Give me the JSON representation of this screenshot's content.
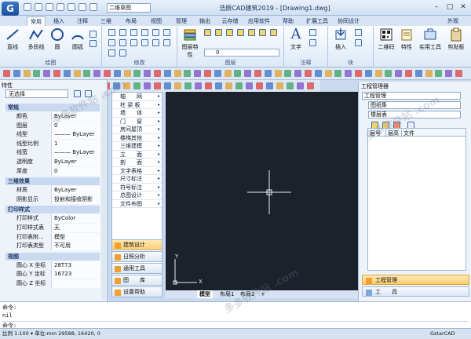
{
  "app": {
    "logo": "G",
    "title": "浩辰CAD建筑2019 - [Drawing1.dwg]",
    "workspace": "二维草图"
  },
  "tabs": [
    "常用",
    "插入",
    "注释",
    "三维",
    "布局",
    "视图",
    "管理",
    "输出",
    "云存储",
    "应用软件",
    "帮助",
    "扩展工具",
    "协同设计",
    "外观"
  ],
  "ribbon": {
    "draw": {
      "name": "绘图",
      "buttons": [
        "直线",
        "多段线",
        "圆",
        "圆弧"
      ]
    },
    "modify": {
      "name": "修改"
    },
    "layer": {
      "name": "图层",
      "button": "图层特性",
      "layer_value": "0"
    },
    "annotation": {
      "name": "注释",
      "button": "文字"
    },
    "block": {
      "name": "块",
      "button": "插入"
    },
    "extra": [
      "二维码",
      "特性",
      "实用工具",
      "剪贴板"
    ]
  },
  "properties": {
    "title": "特性",
    "selection": "无选择",
    "sections": [
      {
        "name": "常规",
        "rows": [
          [
            "颜色",
            "ByLayer"
          ],
          [
            "图层",
            "0"
          ],
          [
            "线型",
            "——— ByLayer"
          ],
          [
            "线型比例",
            "1"
          ],
          [
            "线宽",
            "——— ByLayer"
          ],
          [
            "透明度",
            "ByLayer"
          ],
          [
            "厚度",
            "0"
          ]
        ]
      },
      {
        "name": "三维效果",
        "rows": [
          [
            "材质",
            "ByLayer"
          ],
          [
            "阴影显示",
            "投射和接收阴影"
          ]
        ]
      },
      {
        "name": "打印样式",
        "rows": [
          [
            "打印样式",
            "ByColor"
          ],
          [
            "打印样式表",
            "无"
          ],
          [
            "打印表附...",
            "模型"
          ],
          [
            "打印表类型",
            "不可用"
          ]
        ]
      },
      {
        "name": "视图",
        "rows": [
          [
            "圆心 X 坐标",
            "28T73"
          ],
          [
            "圆心 Y 坐标",
            "16723"
          ],
          [
            "圆心 Z 坐标",
            ""
          ]
        ]
      }
    ]
  },
  "menu": {
    "items": [
      "轴　　网",
      "柱 梁 板",
      "墙　　体",
      "门　　窗",
      "房间屋顶",
      "楼梯其他",
      "三维建模",
      "立　　面",
      "剖　　面",
      "文字表格",
      "尺寸标注",
      "符号标注",
      "总图设计",
      "文件布图"
    ],
    "bottom": [
      "建筑设计",
      "日照分析",
      "通用工具",
      "图　　库",
      "设置帮助"
    ]
  },
  "canvas": {
    "axis_x": "X",
    "axis_y": "Y",
    "tabs": [
      "模型",
      "布局1",
      "布局2",
      "+"
    ]
  },
  "right_panel": {
    "title": "工程管理器",
    "combos": [
      "工程管理",
      "图纸集",
      "楼层表"
    ],
    "columns": [
      "层号",
      "层高",
      "文件"
    ],
    "buttons": [
      "工程管理",
      "工　　具"
    ]
  },
  "command": {
    "lines": [
      "命令:",
      "nil",
      "命令:"
    ]
  },
  "status": {
    "text": "比例 1:100 ▾   单位:mm  29588, 16420, 0",
    "right": "GstarCAD"
  },
  "watermark": "多多软件站 .com",
  "colors": {
    "accent": "#f0a030",
    "canvas": "#1c222c",
    "ribbon": "#dde9f7"
  }
}
